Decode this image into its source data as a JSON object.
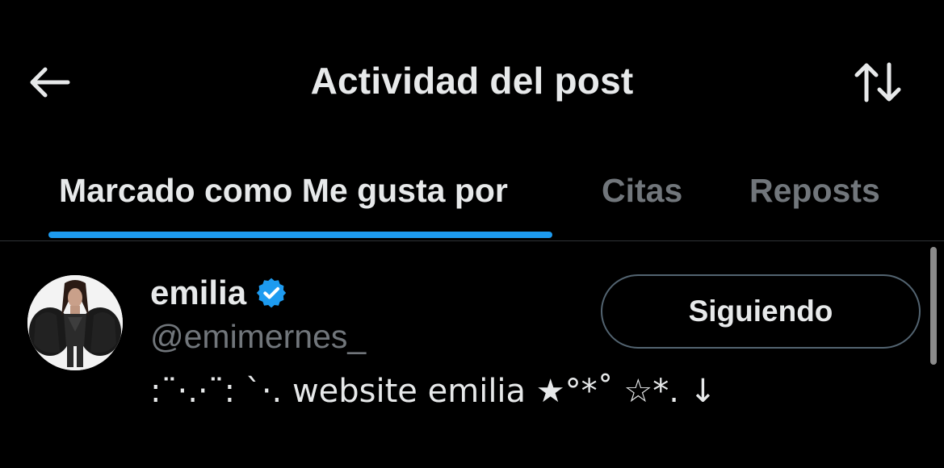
{
  "header": {
    "title": "Actividad del post",
    "back_icon": "arrow-left-icon",
    "sort_icon": "sort-arrows-icon"
  },
  "tabs": [
    {
      "label": "Marcado como Me gusta por",
      "active": true
    },
    {
      "label": "Citas",
      "active": false
    },
    {
      "label": "Reposts",
      "active": false
    }
  ],
  "user": {
    "display_name": "emilia",
    "verified": true,
    "handle": "@emimernes_",
    "bio": ":¨·.·¨: `·. website emilia ★°*˚ ☆*. ↓",
    "follow_label": "Siguiendo"
  },
  "colors": {
    "background": "#000000",
    "text_primary": "#e7e9ea",
    "text_secondary": "#71767b",
    "accent": "#1d9bf0",
    "border": "#2f3336"
  }
}
